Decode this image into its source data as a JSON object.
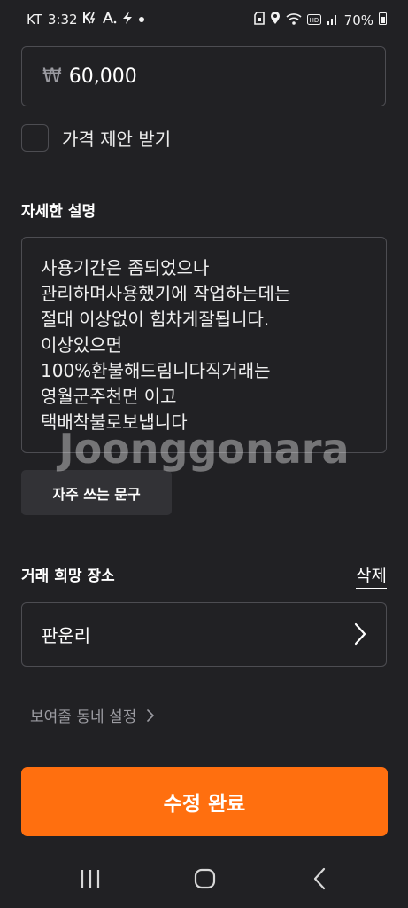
{
  "status_bar": {
    "carrier": "KT",
    "time": "3:32",
    "notif_icons": [
      "k-bolt-icon",
      "a-icon",
      "bolt-icon",
      "dot-icon"
    ],
    "right_icons": [
      "sim-icon",
      "location-icon",
      "wifi-icon",
      "hd-icon",
      "signal-icon",
      "battery-icon"
    ],
    "battery": "70%"
  },
  "price": {
    "currency": "₩",
    "value": "60,000"
  },
  "offer": {
    "label": "가격 제안 받기",
    "checked": false
  },
  "description": {
    "title": "자세한 설명",
    "lines": [
      "사용기간은 좀되었으나",
      "관리하며사용했기에 작업하는데는",
      "절대 이상없이 힘차게잘됩니다.",
      "이상있으면",
      "100%환불해드림니다직거래는",
      "영월군주천면 이고",
      "택배착불로보냅니다"
    ]
  },
  "watermark": "Joonggonara",
  "phrases_button": "자주 쓰는 문구",
  "location": {
    "title": "거래 희망 장소",
    "delete_label": "삭제",
    "value": "판운리"
  },
  "neighborhood_link": "보여줄 동네 설정",
  "submit_label": "수정 완료",
  "nav_bar": {
    "icons": [
      "recent-apps-icon",
      "home-icon",
      "back-icon"
    ]
  },
  "colors": {
    "background": "#212124",
    "accent": "#ff6f0f",
    "border": "#4d4d52",
    "muted_text": "#9c9ca2"
  }
}
